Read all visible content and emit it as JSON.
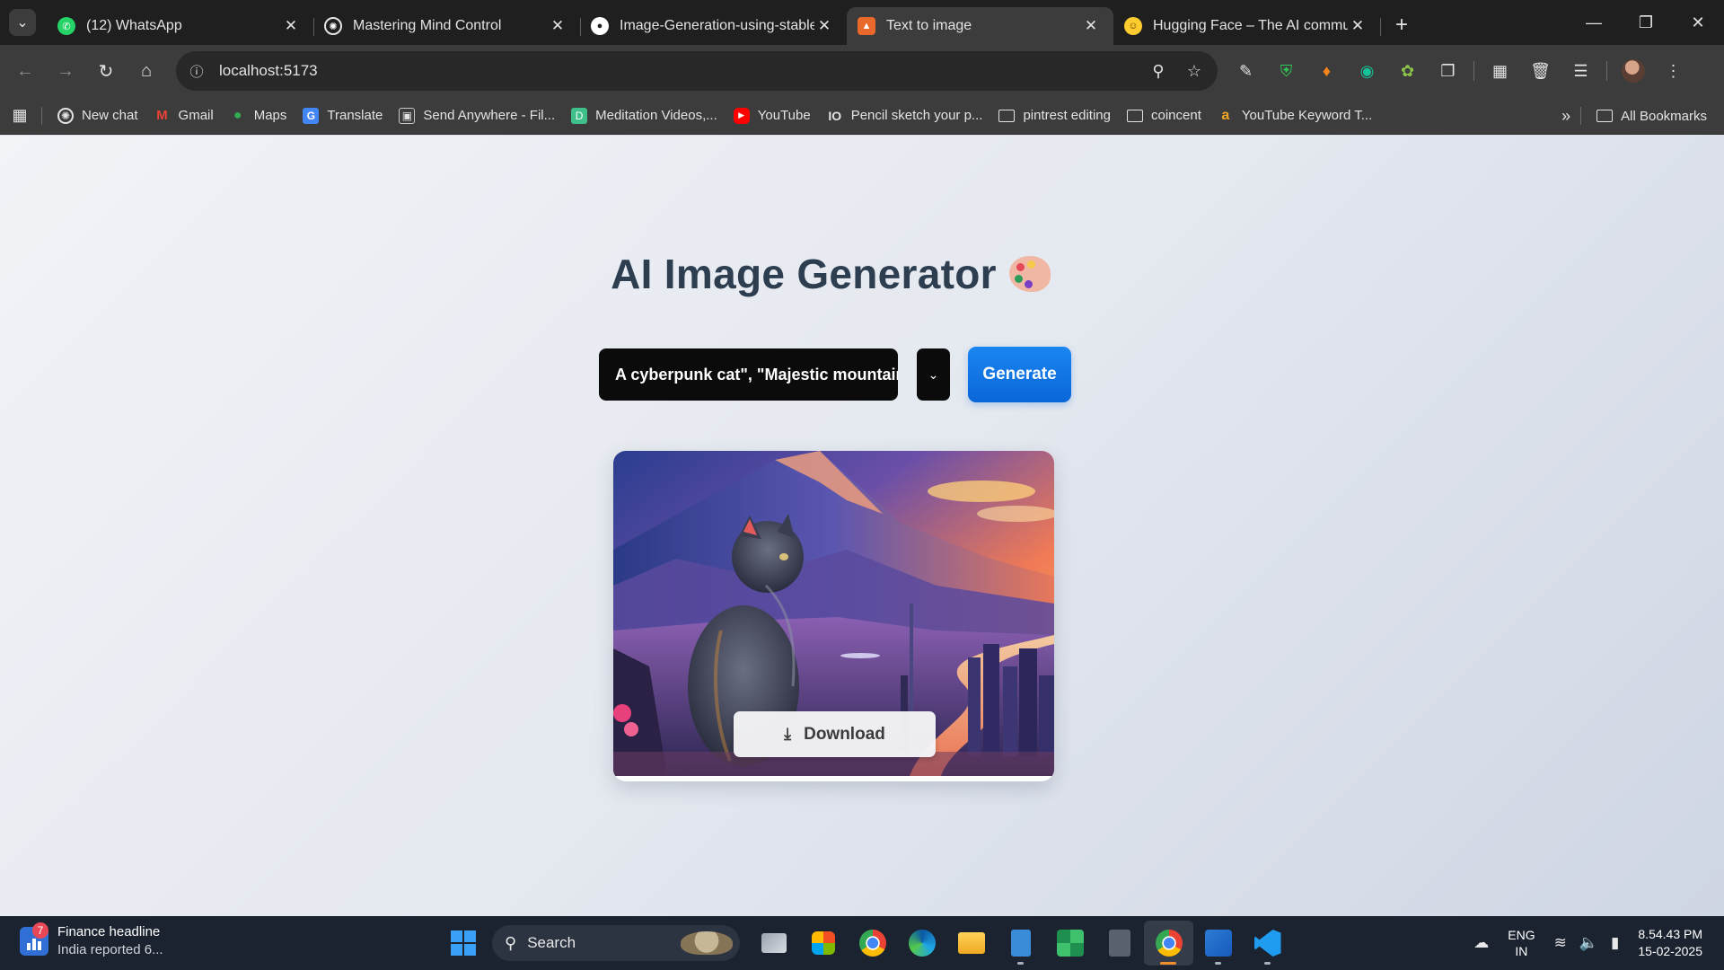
{
  "tabs": [
    {
      "title": "(12) WhatsApp",
      "icon": "whatsapp-icon",
      "color": "#25d366",
      "active": false
    },
    {
      "title": "Mastering Mind Control",
      "icon": "chatgpt-icon",
      "color": "#ffffff",
      "active": false
    },
    {
      "title": "Image-Generation-using-stable",
      "icon": "github-icon",
      "color": "#ffffff",
      "active": false
    },
    {
      "title": "Text to image",
      "icon": "vite-icon",
      "color": "#e8692b",
      "active": true
    },
    {
      "title": "Hugging Face – The AI commun",
      "icon": "huggingface-icon",
      "color": "#ffcc2f",
      "active": false
    }
  ],
  "toolbar": {
    "url": "localhost:5173"
  },
  "bookmarks": [
    {
      "label": "New chat",
      "icon": "chatgpt-icon",
      "color": "#ffffff"
    },
    {
      "label": "Gmail",
      "icon": "gmail-icon",
      "color": "#ea4335"
    },
    {
      "label": "Maps",
      "icon": "maps-icon",
      "color": "#34a853"
    },
    {
      "label": "Translate",
      "icon": "translate-icon",
      "color": "#4285f4"
    },
    {
      "label": "Send Anywhere - Fil...",
      "icon": "send-anywhere-icon",
      "color": "#9aa0a6"
    },
    {
      "label": "Meditation Videos,...",
      "icon": "meditation-icon",
      "color": "#3fbf8a"
    },
    {
      "label": "YouTube",
      "icon": "youtube-icon",
      "color": "#ff0000"
    },
    {
      "label": "Pencil sketch your p...",
      "icon": "io-icon",
      "color": "#e3e3e3"
    },
    {
      "label": "pintrest editing",
      "icon": "folder-icon",
      "color": "#e3e3e3"
    },
    {
      "label": "coincent",
      "icon": "folder-icon",
      "color": "#e3e3e3"
    },
    {
      "label": "YouTube Keyword T...",
      "icon": "keyword-tool-icon",
      "color": "#f5a623"
    }
  ],
  "all_bookmarks_label": "All Bookmarks",
  "app": {
    "title": "AI Image Generator",
    "prompt_text": "A cyberpunk cat\", \"Majestic mountain",
    "generate_label": "Generate",
    "download_label": "Download"
  },
  "taskbar": {
    "news_badge": "7",
    "news_title": "Finance headline",
    "news_sub": "India reported 6...",
    "search_label": "Search",
    "lang_line1": "ENG",
    "lang_line2": "IN",
    "time": "8.54.43 PM",
    "date": "15-02-2025"
  },
  "colors": {
    "accent": "#0a66d8",
    "title": "#2c3e50"
  }
}
